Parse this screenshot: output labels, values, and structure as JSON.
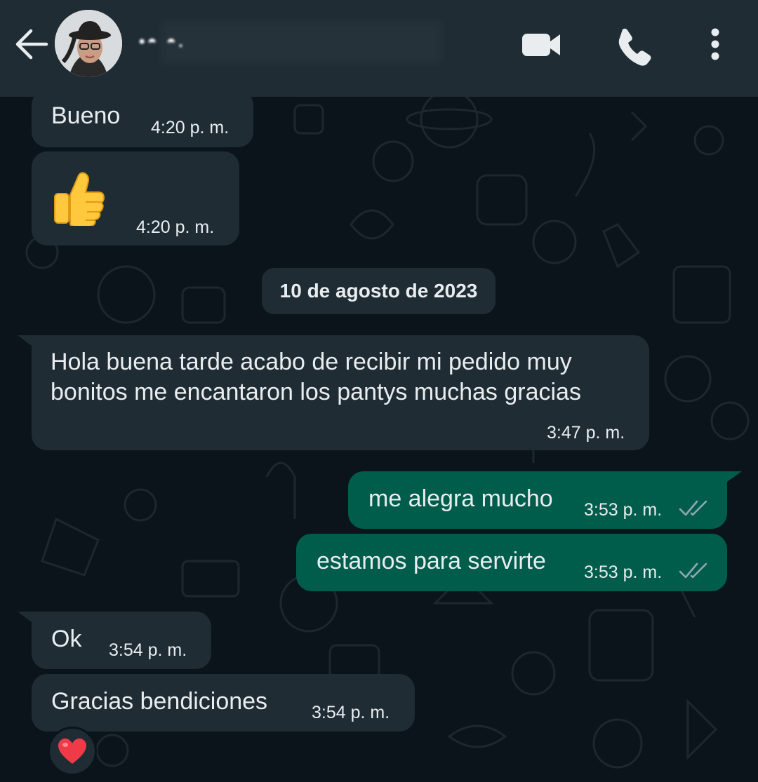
{
  "header": {
    "contact_name": "•◓ ◓.",
    "back_icon": "arrow-left-icon",
    "video_icon": "video-camera-icon",
    "call_icon": "phone-icon",
    "menu_icon": "more-vertical-icon"
  },
  "date_divider": "10 de agosto de 2023",
  "messages": [
    {
      "direction": "incoming",
      "text": "Bueno",
      "time": "4:20 p. m."
    },
    {
      "direction": "incoming",
      "text": "👍",
      "time": "4:20 p. m."
    },
    {
      "direction": "incoming",
      "text_lines": [
        "Hola buena tarde acabo de recibir mi pedido muy",
        "bonitos me encantaron los pantys muchas gracias"
      ],
      "time": "3:47 p. m."
    },
    {
      "direction": "outgoing",
      "text": "me alegra mucho",
      "time": "3:53 p. m.",
      "status": "read"
    },
    {
      "direction": "outgoing",
      "text": "estamos para servirte",
      "time": "3:53 p. m.",
      "status": "read"
    },
    {
      "direction": "incoming",
      "text": "Ok",
      "time": "3:54 p. m."
    },
    {
      "direction": "incoming",
      "text": "Gracias bendiciones",
      "time": "3:54 p. m.",
      "reaction": "❤️"
    }
  ],
  "colors": {
    "background": "#0b141a",
    "header": "#1f2c34",
    "incoming_bubble": "#1f2c34",
    "outgoing_bubble": "#005c4b",
    "read_ticks": "#8fa9b5"
  }
}
